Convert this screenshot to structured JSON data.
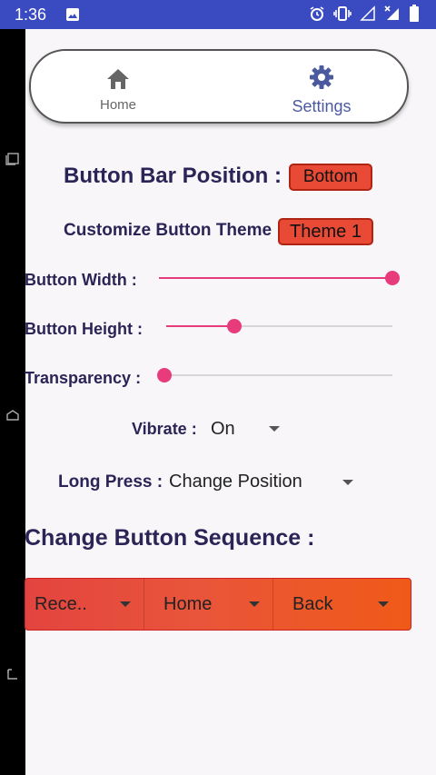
{
  "status_bar": {
    "time": "1:36"
  },
  "nav": {
    "home_label": "Home",
    "settings_label": "Settings"
  },
  "button_bar_position": {
    "label": "Button Bar Position :",
    "value": "Bottom"
  },
  "button_theme": {
    "label": "Customize Button Theme :",
    "value": "Theme 1"
  },
  "sliders": [
    {
      "label": "Button Width :",
      "level": 1.0
    },
    {
      "label": "Button Height :",
      "level": 0.3
    },
    {
      "label": "Transparency :",
      "level": 0.0
    }
  ],
  "vibrate": {
    "label": "Vibrate :",
    "value": "On"
  },
  "long_press": {
    "label": "Long Press :",
    "value": "Change Position"
  },
  "sequence": {
    "title": "Change Button Sequence :",
    "items": [
      "Rece..",
      "Home",
      "Back"
    ]
  },
  "colors": {
    "status_bar": "#3a4ac0",
    "heading_text": "#2b2456",
    "accent_pill": "#e84a35",
    "slider": "#e73b7c",
    "sequence_gradient_start": "#e3443f",
    "sequence_gradient_end": "#f05a18"
  }
}
